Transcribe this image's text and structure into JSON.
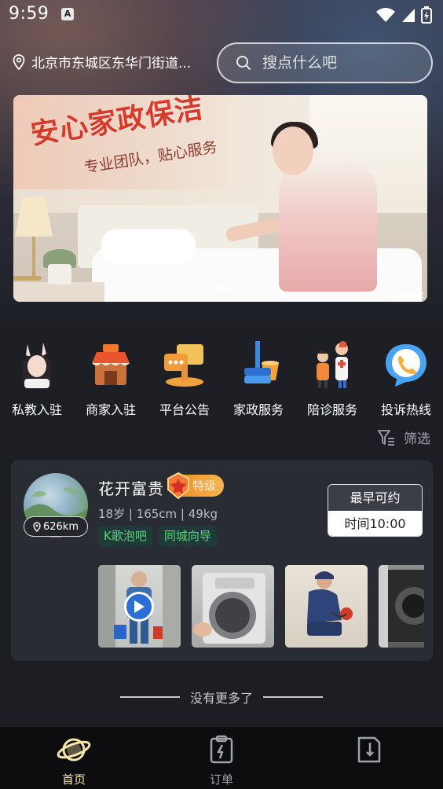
{
  "status_bar": {
    "time": "9:59",
    "notification_badge": "A"
  },
  "header": {
    "location": "北京市东城区东华门街道...",
    "search_placeholder": "搜点什么吧"
  },
  "banner": {
    "title": "安心家政保洁",
    "subtitle": "专业团队，贴心服务",
    "watermark": "豆包AI生成"
  },
  "quick_menu": [
    {
      "label": "私教入驻",
      "icon": "coach-icon"
    },
    {
      "label": "商家入驻",
      "icon": "shop-icon"
    },
    {
      "label": "平台公告",
      "icon": "announcement-icon"
    },
    {
      "label": "家政服务",
      "icon": "cleaning-icon"
    },
    {
      "label": "陪诊服务",
      "icon": "medical-escort-icon"
    },
    {
      "label": "投诉热线",
      "icon": "hotline-icon"
    }
  ],
  "filter": {
    "label": "筛选"
  },
  "provider": {
    "name": "花开富贵",
    "level": "特级",
    "distance": "626km",
    "info": "18岁 | 165cm | 49kg",
    "tags": [
      "K歌泡吧",
      "同城向导"
    ],
    "earliest_label": "最早可约",
    "earliest_time": "时间10:00"
  },
  "list_end": "没有更多了",
  "tab_bar": {
    "items": [
      {
        "label": "首页",
        "active": true
      },
      {
        "label": "订单",
        "active": false
      },
      {
        "label": "",
        "active": false
      }
    ]
  },
  "colors": {
    "accent_green": "#58d67c",
    "badge_orange": "#f2a03a",
    "banner_red": "#d8392b",
    "card_bg": "#2a2c33"
  }
}
